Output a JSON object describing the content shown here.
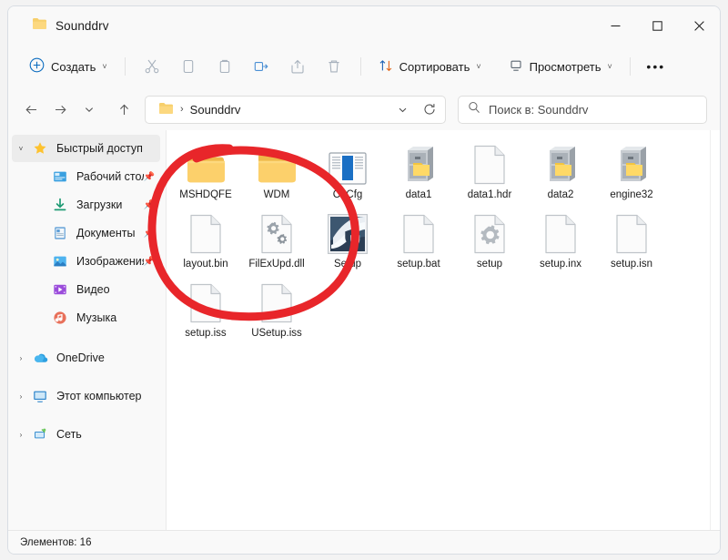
{
  "window": {
    "title": "Sounddrv",
    "title_icon": "folder-icon",
    "controls": {
      "minimize": "─",
      "maximize": "☐",
      "close": "✕"
    }
  },
  "toolbar": {
    "new_label": "Создать",
    "new_icon": "plus-circle-icon",
    "icon_buttons": [
      {
        "name": "cut-button",
        "icon": "scissors-icon"
      },
      {
        "name": "copy-button",
        "icon": "copy-icon"
      },
      {
        "name": "paste-button",
        "icon": "paste-icon"
      },
      {
        "name": "rename-button",
        "icon": "rename-icon"
      },
      {
        "name": "share-button",
        "icon": "share-icon"
      },
      {
        "name": "delete-button",
        "icon": "trash-icon"
      }
    ],
    "sort_label": "Сортировать",
    "sort_icon": "sort-arrows-icon",
    "view_label": "Просмотреть",
    "view_icon": "monitor-icon",
    "more_label": "•••",
    "chevron": "˅"
  },
  "address": {
    "back_icon": "arrow-left-icon",
    "forward_icon": "arrow-right-icon",
    "recent_icon": "chevron-down-icon",
    "up_icon": "arrow-up-icon",
    "crumb_icon": "folder-icon",
    "crumb_sep": "›",
    "crumb_label": "Sounddrv",
    "dropdown_icon": "chevron-down-icon",
    "refresh_icon": "refresh-icon"
  },
  "search": {
    "icon": "search-icon",
    "placeholder": "Поиск в: Sounddrv"
  },
  "sidebar": {
    "items": [
      {
        "label": "Быстрый доступ",
        "icon": "star-icon",
        "twisty": "˅",
        "level": 0,
        "selected": true,
        "pinned": false,
        "name": "sidebar-item-quick-access"
      },
      {
        "label": "Рабочий стол",
        "icon": "desktop-icon",
        "twisty": "",
        "level": 1,
        "selected": false,
        "pinned": true,
        "name": "sidebar-item-desktop"
      },
      {
        "label": "Загрузки",
        "icon": "downloads-icon",
        "twisty": "",
        "level": 1,
        "selected": false,
        "pinned": true,
        "name": "sidebar-item-downloads"
      },
      {
        "label": "Документы",
        "icon": "documents-icon",
        "twisty": "",
        "level": 1,
        "selected": false,
        "pinned": true,
        "name": "sidebar-item-documents"
      },
      {
        "label": "Изображения",
        "icon": "pictures-icon",
        "twisty": "",
        "level": 1,
        "selected": false,
        "pinned": true,
        "name": "sidebar-item-pictures"
      },
      {
        "label": "Видео",
        "icon": "video-icon",
        "twisty": "",
        "level": 1,
        "selected": false,
        "pinned": false,
        "name": "sidebar-item-videos"
      },
      {
        "label": "Музыка",
        "icon": "music-icon",
        "twisty": "",
        "level": 1,
        "selected": false,
        "pinned": false,
        "name": "sidebar-item-music"
      },
      {
        "label": "OneDrive",
        "icon": "onedrive-icon",
        "twisty": "›",
        "level": 0,
        "selected": false,
        "pinned": false,
        "name": "sidebar-item-onedrive"
      },
      {
        "label": "Этот компьютер",
        "icon": "this-pc-icon",
        "twisty": "›",
        "level": 0,
        "selected": false,
        "pinned": false,
        "name": "sidebar-item-this-pc"
      },
      {
        "label": "Сеть",
        "icon": "network-icon",
        "twisty": "›",
        "level": 0,
        "selected": false,
        "pinned": false,
        "name": "sidebar-item-network"
      }
    ]
  },
  "files": [
    {
      "label": "MSHDQFE",
      "icon": "folder-icon"
    },
    {
      "label": "WDM",
      "icon": "folder-icon"
    },
    {
      "label": "ChCfg",
      "icon": "application-window-icon"
    },
    {
      "label": "data1",
      "icon": "cabinet-icon"
    },
    {
      "label": "data1.hdr",
      "icon": "blank-file-icon"
    },
    {
      "label": "data2",
      "icon": "cabinet-icon"
    },
    {
      "label": "engine32",
      "icon": "cabinet-icon"
    },
    {
      "label": "layout.bin",
      "icon": "blank-file-icon"
    },
    {
      "label": "FilExUpd.dll",
      "icon": "gears-file-icon"
    },
    {
      "label": "Setup",
      "icon": "setup-shield-icon"
    },
    {
      "label": "setup.bat",
      "icon": "blank-file-icon"
    },
    {
      "label": "setup",
      "icon": "gear-file-icon"
    },
    {
      "label": "setup.inx",
      "icon": "blank-file-icon"
    },
    {
      "label": "setup.isn",
      "icon": "blank-file-icon"
    },
    {
      "label": "setup.iss",
      "icon": "blank-file-icon"
    },
    {
      "label": "USetup.iss",
      "icon": "blank-file-icon"
    }
  ],
  "statusbar": {
    "items_text": "Элементов: 16"
  },
  "annotation": {
    "shape": "red-ellipse",
    "color": "#e8262a"
  }
}
